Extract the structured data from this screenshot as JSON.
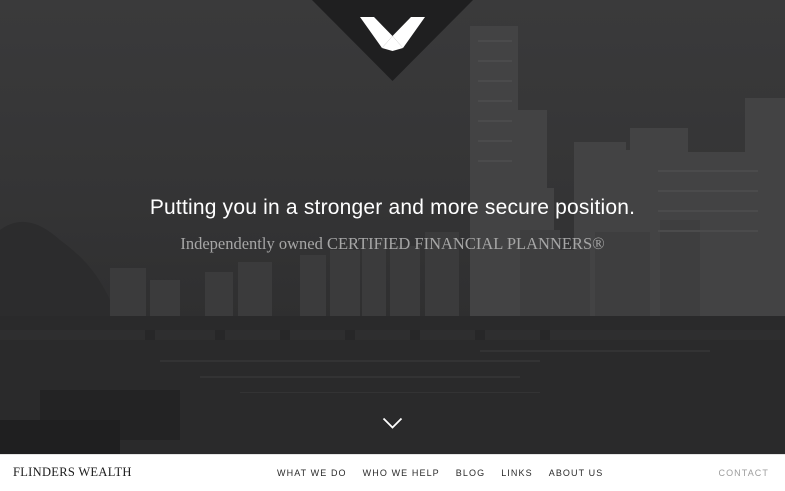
{
  "hero": {
    "headline": "Putting you in a stronger and more secure position.",
    "subheadline": "Independently owned CERTIFIED FINANCIAL PLANNERS®",
    "logo_icon": "v-monogram-icon",
    "scroll_icon": "chevron-down-icon"
  },
  "nav": {
    "brand": "FLINDERS WEALTH",
    "items": [
      {
        "label": "WHAT WE DO"
      },
      {
        "label": "WHO WE HELP"
      },
      {
        "label": "BLOG"
      },
      {
        "label": "LINKS"
      },
      {
        "label": "ABOUT US"
      }
    ],
    "contact": "CONTACT"
  },
  "colors": {
    "overlay": "#2b2b2c",
    "logo_badge": "#1f1f20",
    "headline": "#ffffff",
    "subheadline": "#a6a6a6",
    "navbar_bg": "#ffffff",
    "nav_text": "#2a2a2a",
    "contact_text": "#9d9d9d"
  }
}
